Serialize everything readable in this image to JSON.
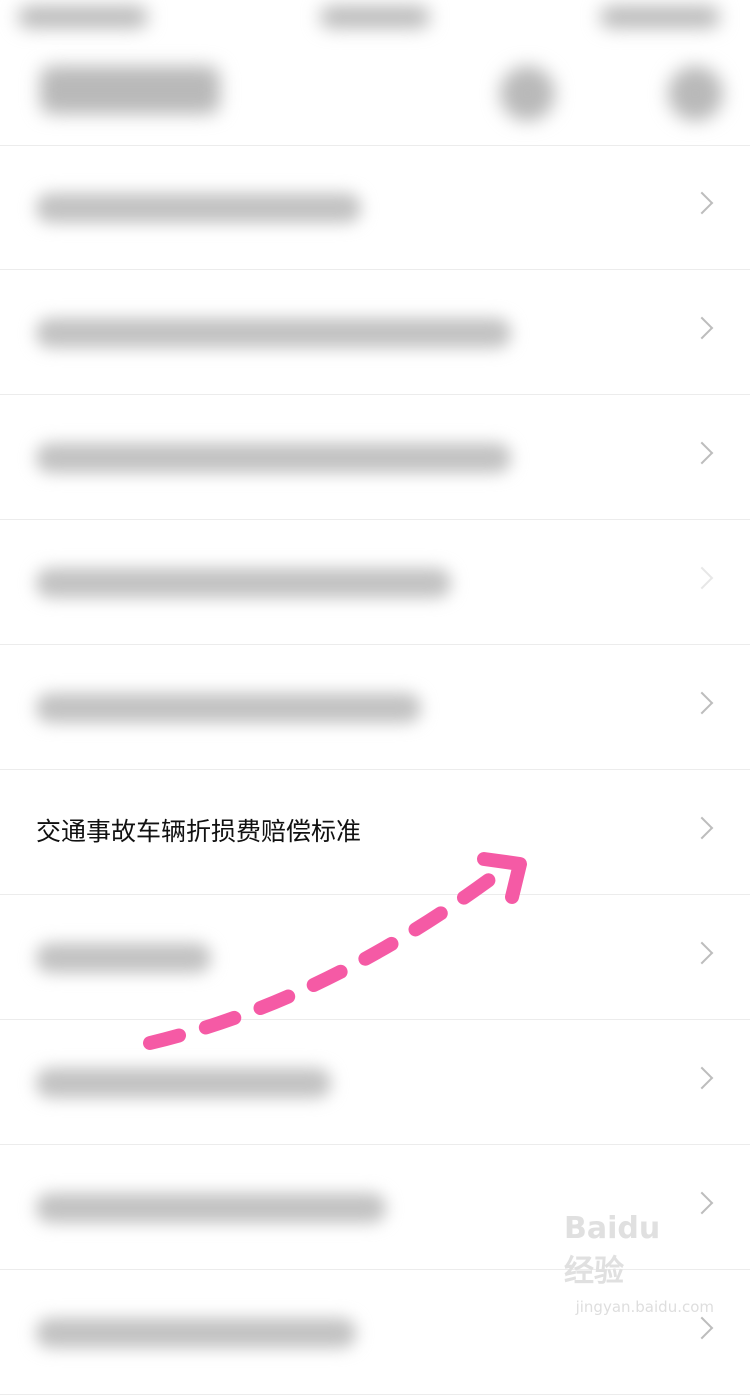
{
  "highlighted_item": {
    "label": "交通事故车辆折损费赔偿标准"
  },
  "list_items": [
    {
      "label": "",
      "blurred": true
    },
    {
      "label": "",
      "blurred": true
    },
    {
      "label": "",
      "blurred": true
    },
    {
      "label": "",
      "blurred": true
    },
    {
      "label": "",
      "blurred": true
    },
    {
      "label": "交通事故车辆折损费赔偿标准",
      "blurred": false
    },
    {
      "label": "",
      "blurred": true
    },
    {
      "label": "",
      "blurred": true
    },
    {
      "label": "",
      "blurred": true
    },
    {
      "label": "",
      "blurred": true
    }
  ],
  "annotation": {
    "color": "#f55aa5"
  },
  "watermark": {
    "logo": "Baidu经验",
    "url": "jingyan.baidu.com"
  },
  "icons": [
    "back-icon",
    "search-icon",
    "more-icon",
    "chevron-right-icon"
  ]
}
